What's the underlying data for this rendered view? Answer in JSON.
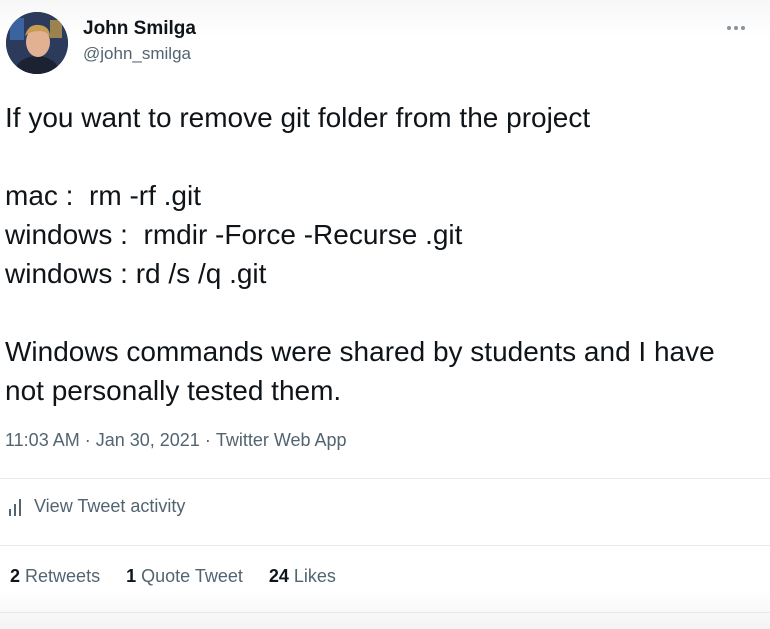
{
  "author": {
    "name": "John Smilga",
    "handle": "@john_smilga"
  },
  "tweet": {
    "lines": [
      "If you want to remove git folder from the project",
      "",
      "mac :  rm -rf .git",
      "windows :  rmdir -Force -Recurse .git",
      "windows : rd /s /q .git",
      "",
      "Windows commands were shared by students and I have",
      "not personally tested them."
    ]
  },
  "meta": {
    "time": "11:03 AM",
    "date": "Jan 30, 2021",
    "source": "Twitter Web App",
    "separator": "·"
  },
  "activity": {
    "label": "View Tweet activity",
    "icon": "bar-chart-icon"
  },
  "stats": {
    "retweets_count": "2",
    "retweets_label": "Retweets",
    "quote_count": "1",
    "quote_label": "Quote Tweet",
    "likes_count": "24",
    "likes_label": "Likes"
  },
  "menu": {
    "icon": "more-horizontal-icon"
  }
}
